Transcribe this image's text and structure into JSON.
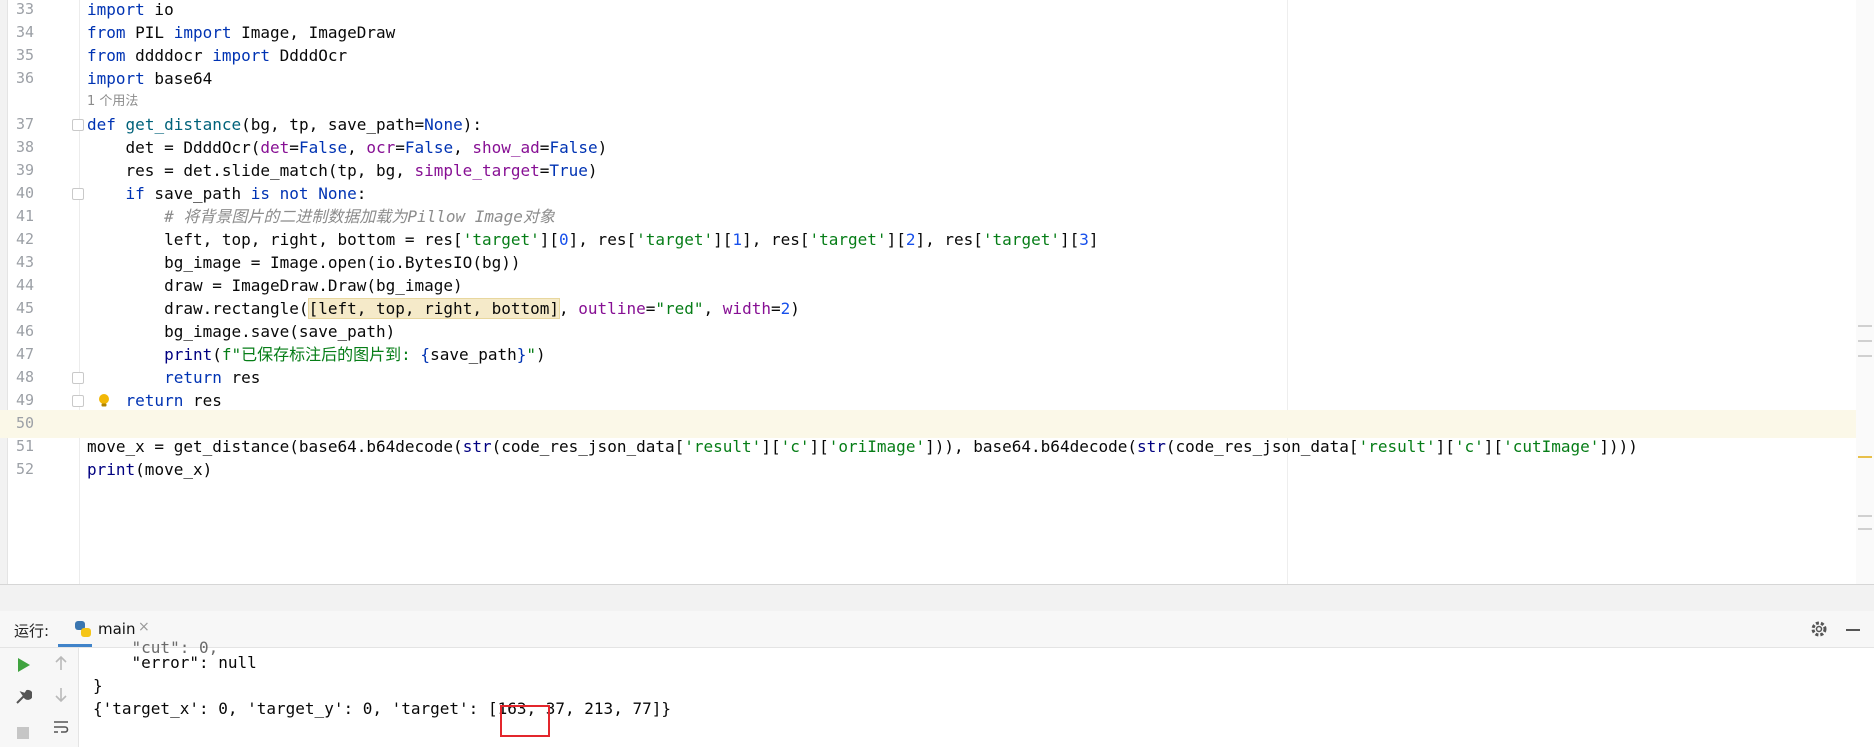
{
  "editor": {
    "hint_usage": "1 个用法",
    "line_numbers": [
      "33",
      "34",
      "35",
      "36",
      "37",
      "38",
      "39",
      "40",
      "41",
      "42",
      "43",
      "44",
      "45",
      "46",
      "47",
      "48",
      "49",
      "50",
      "51",
      "52"
    ],
    "lines": {
      "l33": {
        "kw1": "import",
        "rest": " io"
      },
      "l34": {
        "kw1": "from",
        "mid": " PIL ",
        "kw2": "import",
        "rest": " Image, ImageDraw"
      },
      "l35": {
        "kw1": "from",
        "mid": " ddddocr ",
        "kw2": "import",
        "rest": " DdddOcr"
      },
      "l36": {
        "kw1": "import",
        "rest": " base64"
      },
      "l37": {
        "kw": "def",
        "sp": " ",
        "fn": "get_distance",
        "args": "(bg, tp, save_path=",
        "none": "None",
        "close": "):"
      },
      "l38": {
        "a": "    det = DdddOcr(",
        "p1": "det",
        "e1": "=",
        "v1": "False",
        "c1": ", ",
        "p2": "ocr",
        "e2": "=",
        "v2": "False",
        "c2": ", ",
        "p3": "show_ad",
        "e3": "=",
        "v3": "False",
        "end": ")"
      },
      "l39": {
        "a": "    res = det.slide_match(tp, bg, ",
        "p1": "simple_target",
        "e1": "=",
        "v1": "True",
        "end": ")"
      },
      "l40": {
        "ind": "    ",
        "kw1": "if",
        "m1": " save_path ",
        "kw2": "is not",
        "m2": " ",
        "none": "None",
        "end": ":"
      },
      "l41": {
        "ind": "        ",
        "cmt": "# 将背景图片的二进制数据加载为Pillow Image对象"
      },
      "l42": {
        "a": "        left, top, right, bottom = res[",
        "s1": "'target'",
        "b1": "][",
        "n1": "0",
        "c1": "], res[",
        "s2": "'target'",
        "b2": "][",
        "n2": "1",
        "c2": "], res[",
        "s3": "'target'",
        "b3": "][",
        "n3": "2",
        "c3": "], res[",
        "s4": "'target'",
        "b4": "][",
        "n4": "3",
        "end": "]"
      },
      "l43": {
        "a": "        bg_image = Image.open(io.BytesIO(bg))"
      },
      "l44": {
        "a": "        draw = ImageDraw.Draw(bg_image)"
      },
      "l45": {
        "a": "        draw.rectangle(",
        "hl": "[left, top, right, bottom]",
        "c1": ", ",
        "p1": "outline",
        "e1": "=",
        "s1": "\"red\"",
        "c2": ", ",
        "p2": "width",
        "e2": "=",
        "n1": "2",
        "end": ")"
      },
      "l46": {
        "a": "        bg_image.save(save_path)"
      },
      "l47": {
        "ind": "        ",
        "bi": "print",
        "o": "(",
        "s1": "f\"已保存标注后的图片到: ",
        "br1": "{",
        "v": "save_path",
        "br2": "}",
        "s2": "\"",
        "end": ")"
      },
      "l48": {
        "ind": "        ",
        "kw": "return",
        "rest": " res"
      },
      "l49": {
        "ind": "    ",
        "kw": "return",
        "rest": " res"
      },
      "l51": {
        "a": "move_x = get_distance(base64.b64decode(",
        "bi1": "str",
        "b": "(code_res_json_data[",
        "s1": "'result'",
        "x1": "][",
        "s2": "'c'",
        "x2": "][",
        "s3": "'oriImage'",
        "m": "])), base64.b64decode(",
        "bi2": "str",
        "b2": "(code_res_json_data[",
        "s4": "'result'",
        "x3": "][",
        "s5": "'c'",
        "x4": "][",
        "s6": "'cutImage'",
        "end": "])))"
      },
      "l52": {
        "bi": "print",
        "rest": "(move_x)"
      }
    }
  },
  "run_panel": {
    "label": "运行:",
    "tab_name": "main",
    "tab_close": "×",
    "console": {
      "partial": "    \"cut\": 0,",
      "error_line": "    \"error\": null",
      "brace": "}",
      "result_prefix": "{'target_x': 0, 'target_y': 0, 'target': ",
      "result_first": "[163,",
      "result_rest": " 37, 213, 77]}"
    }
  },
  "colors": {
    "keyword": "#0033b3",
    "string": "#067d17",
    "number": "#1750eb",
    "param": "#871094",
    "highlight_box": "#e3262c",
    "tab_underline": "#4083c9"
  }
}
